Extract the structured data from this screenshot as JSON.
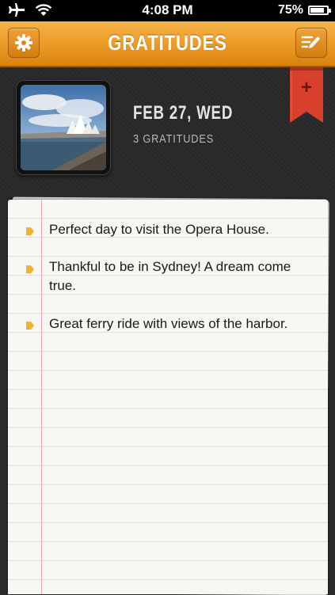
{
  "status_bar": {
    "time": "4:08 PM",
    "battery_text": "75%",
    "battery_level": 0.75,
    "icons": [
      "airplane-icon",
      "wifi-icon",
      "battery-icon"
    ]
  },
  "nav": {
    "title": "GRATITUDES",
    "left_icon": "gear-icon",
    "right_icon": "compose-icon"
  },
  "header": {
    "date": "FEB 27, WED",
    "count": "3 GRATITUDES",
    "ribbon_symbol": "+"
  },
  "entries": [
    {
      "text": "Perfect day to visit the Opera House."
    },
    {
      "text": "Thankful to be in Sydney! A dream come true."
    },
    {
      "text": "Great ferry ride with views of the harbor."
    }
  ],
  "colors": {
    "accent": "#e99a26",
    "ribbon": "#d9402c",
    "bullet": "#f0b233"
  }
}
